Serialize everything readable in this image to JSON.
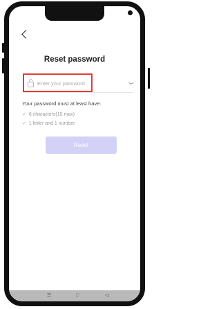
{
  "screen": {
    "title": "Reset password"
  },
  "password_field": {
    "placeholder": "Enter your password",
    "value": ""
  },
  "requirements": {
    "heading": "Your password must at least have:",
    "items": [
      "6 characters(15 max)",
      "1 letter and 1 number"
    ]
  },
  "reset_button": {
    "label": "Reset"
  },
  "nav_bar": {
    "menu_icon": "☰",
    "home_icon": "□",
    "back_icon": "◁"
  },
  "icons": [
    "back-arrow-icon",
    "lock-icon",
    "eye-closed-icon",
    "check-icon",
    "menu-icon",
    "home-icon",
    "back-icon"
  ],
  "colors": {
    "highlight_border": "#e53935",
    "button_disabled": "#d4d1f7",
    "nav_bar": "#b9b9b9"
  }
}
